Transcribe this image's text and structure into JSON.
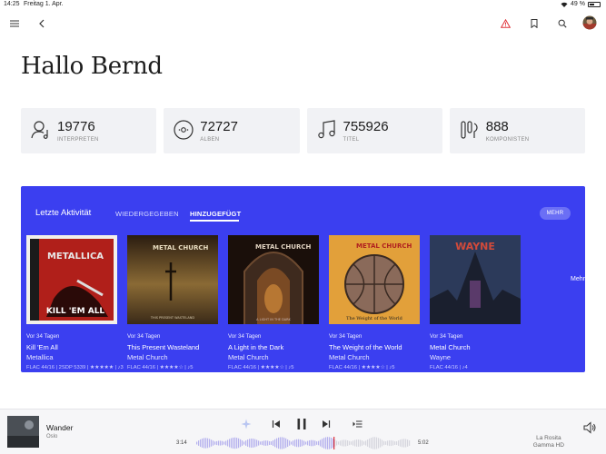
{
  "status_bar": {
    "time": "14:25",
    "date": "Freitag 1. Apr.",
    "battery": "49 %"
  },
  "header": {
    "greeting": "Hallo Bernd"
  },
  "stats": [
    {
      "value": "19776",
      "label": "INTERPRETEN",
      "icon": "artist-icon"
    },
    {
      "value": "72727",
      "label": "ALBEN",
      "icon": "album-disc-icon"
    },
    {
      "value": "755926",
      "label": "TITEL",
      "icon": "music-note-icon"
    },
    {
      "value": "888",
      "label": "KOMPONISTEN",
      "icon": "composer-icon"
    }
  ],
  "activity": {
    "title": "Letzte Aktivität",
    "tabs": [
      "WIEDERGEGEBEN",
      "HINZUGEFÜGT"
    ],
    "active_tab": "HINZUGEFÜGT",
    "more_button": "MEHR",
    "edge_text": "Mehr",
    "albums": [
      {
        "when": "Vor 34 Tagen",
        "title": "Kill 'Em All",
        "artist": "Metallica",
        "meta": "FLAC 44/16 | 2SDP 5339 | ★★★★★ | ♪3"
      },
      {
        "when": "Vor 34 Tagen",
        "title": "This Present Wasteland",
        "artist": "Metal Church",
        "meta": "FLAC 44/16 | ★★★★☆ | ♪5"
      },
      {
        "when": "Vor 34 Tagen",
        "title": "A Light in the Dark",
        "artist": "Metal Church",
        "meta": "FLAC 44/16 | ★★★★☆ | ♪5"
      },
      {
        "when": "Vor 34 Tagen",
        "title": "The Weight of the World",
        "artist": "Metal Church",
        "meta": "FLAC 44/16 | ★★★★☆ | ♪5"
      },
      {
        "when": "Vor 34 Tagen",
        "title": "Metal Church",
        "artist": "Wayne",
        "meta": "FLAC 44/16 | ♪4"
      }
    ],
    "cover_texts": {
      "kill_em_all_logo": "METALLICA",
      "kill_em_all_title": "KILL 'EM ALL",
      "metal_church_logo": "METAL CHURCH",
      "wasteland_caption": "THIS PRESENT WASTELAND",
      "light_caption": "A LIGHT IN THE DARK",
      "weight_caption": "The Weight of the World",
      "wayne_logo": "WAYNE"
    }
  },
  "player": {
    "track": "Wander",
    "artist": "Oslo",
    "elapsed": "3:14",
    "total": "5:02",
    "progress": 0.64,
    "output_line1": "La Rosita",
    "output_line2": "Gamma HD"
  },
  "colors": {
    "accent": "#3b3ff0",
    "warning": "#e0343c",
    "card_bg": "#f1f2f5"
  }
}
